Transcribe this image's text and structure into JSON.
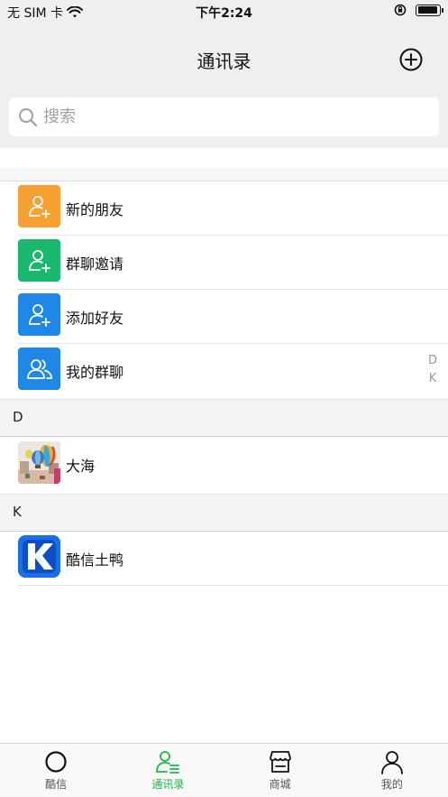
{
  "status_bar": {
    "carrier": "无 SIM 卡",
    "time": "下午2:24",
    "battery_level": 0.92
  },
  "header": {
    "title": "通讯录",
    "add_icon": "plus-circle-icon"
  },
  "search": {
    "placeholder": "搜索",
    "value": ""
  },
  "functions": [
    {
      "label": "新的朋友",
      "icon": "add-person-icon",
      "color": "#f8a133"
    },
    {
      "label": "群聊邀请",
      "icon": "add-person-icon",
      "color": "#1ab76f"
    },
    {
      "label": "添加好友",
      "icon": "add-person-icon",
      "color": "#1f87e6"
    },
    {
      "label": "我的群聊",
      "icon": "group-icon",
      "color": "#1f87e6"
    }
  ],
  "sections": [
    {
      "letter": "D",
      "contacts": [
        {
          "name": "大海",
          "avatar": "balloon-photo-avatar"
        }
      ]
    },
    {
      "letter": "K",
      "contacts": [
        {
          "name": "酷信土鸭",
          "avatar": "k-logo-avatar"
        }
      ]
    }
  ],
  "index": [
    "D",
    "K"
  ],
  "tabs": [
    {
      "label": "酷信",
      "icon": "circle-icon",
      "active": false
    },
    {
      "label": "通讯录",
      "icon": "contacts-icon",
      "active": true
    },
    {
      "label": "商城",
      "icon": "store-icon",
      "active": false
    },
    {
      "label": "我的",
      "icon": "person-icon",
      "active": false
    }
  ],
  "colors": {
    "accent": "#1ab74a",
    "header_bg": "#efefef",
    "k_logo_blue": "#1a6fe8"
  }
}
